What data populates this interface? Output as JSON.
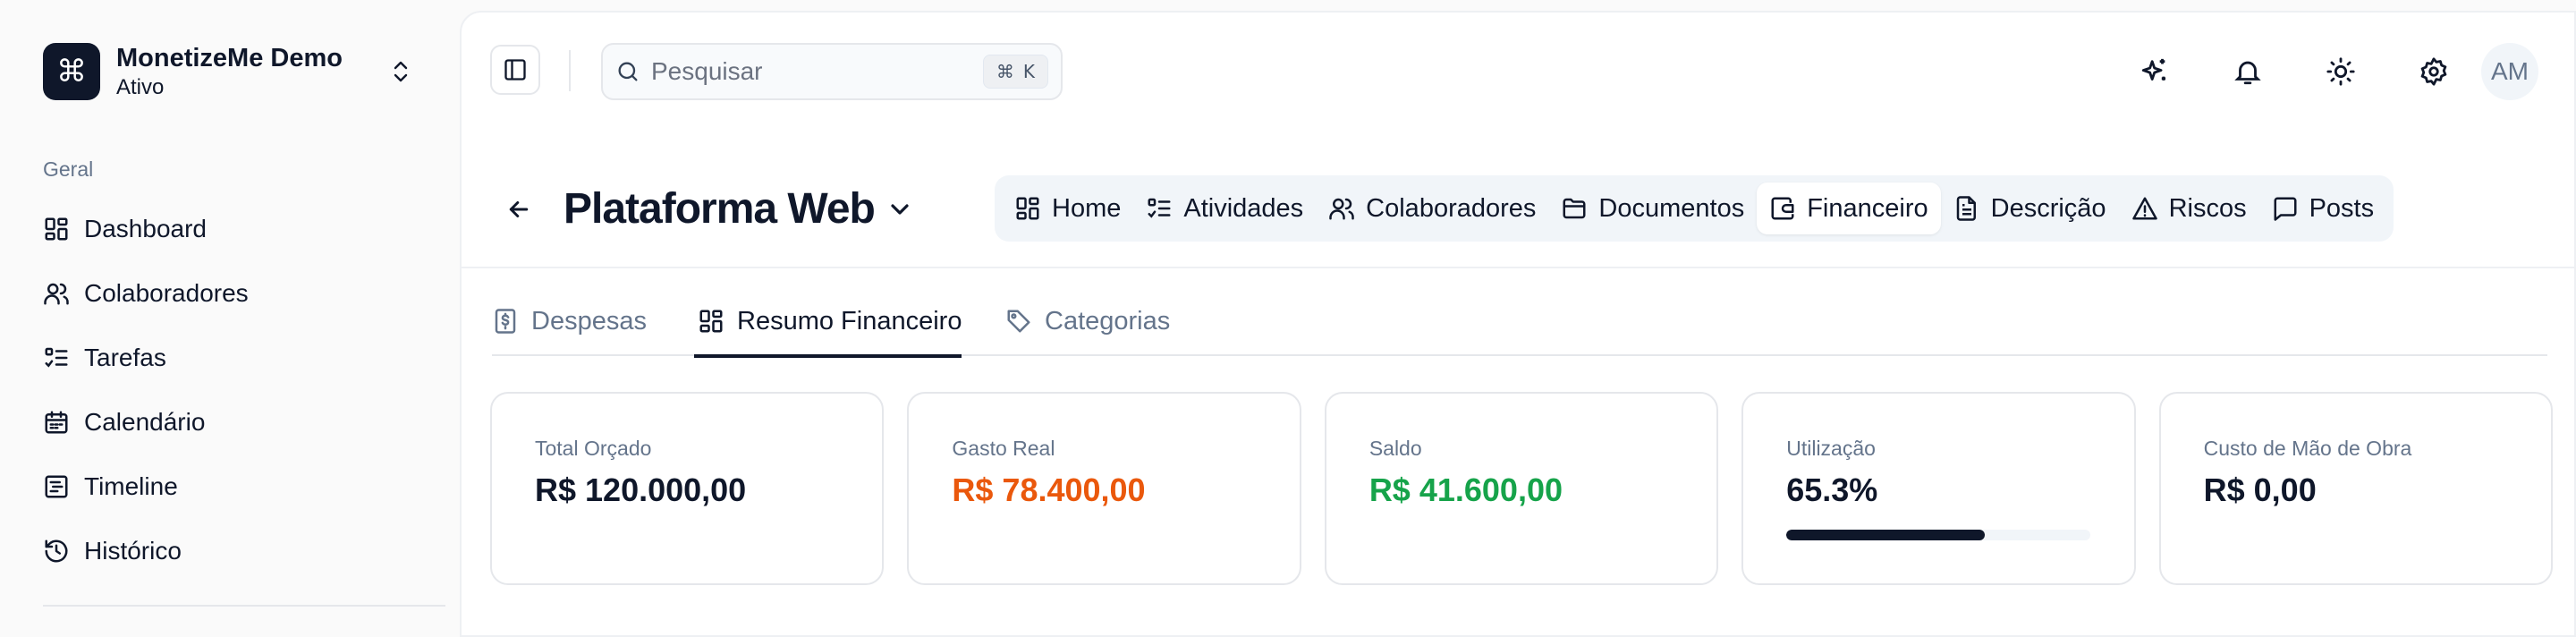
{
  "workspace": {
    "name": "MonetizeMe Demo",
    "status": "Ativo",
    "logo_icon": "command-icon"
  },
  "sidebar": {
    "group_label": "Geral",
    "items": [
      {
        "label": "Dashboard",
        "icon": "dashboard-icon"
      },
      {
        "label": "Colaboradores",
        "icon": "users-icon"
      },
      {
        "label": "Tarefas",
        "icon": "list-check-icon"
      },
      {
        "label": "Calendário",
        "icon": "calendar-icon"
      },
      {
        "label": "Timeline",
        "icon": "timeline-icon"
      },
      {
        "label": "Histórico",
        "icon": "history-icon"
      }
    ]
  },
  "search": {
    "placeholder": "Pesquisar",
    "shortcut_symbol": "⌘",
    "shortcut_key": "K"
  },
  "user": {
    "initials": "AM"
  },
  "project": {
    "title": "Plataforma Web"
  },
  "nav_tabs": [
    {
      "label": "Home",
      "icon": "home-grid-icon",
      "active": false
    },
    {
      "label": "Atividades",
      "icon": "list-check-icon",
      "active": false
    },
    {
      "label": "Colaboradores",
      "icon": "users-icon",
      "active": false
    },
    {
      "label": "Documentos",
      "icon": "folder-icon",
      "active": false
    },
    {
      "label": "Financeiro",
      "icon": "wallet-icon",
      "active": true
    },
    {
      "label": "Descrição",
      "icon": "file-text-icon",
      "active": false
    },
    {
      "label": "Riscos",
      "icon": "alert-triangle-icon",
      "active": false
    },
    {
      "label": "Posts",
      "icon": "message-square-icon",
      "active": false
    }
  ],
  "subtabs": [
    {
      "label": "Despesas",
      "icon": "receipt-dollar-icon",
      "active": false
    },
    {
      "label": "Resumo Financeiro",
      "icon": "dashboard-icon",
      "active": true
    },
    {
      "label": "Categorias",
      "icon": "tag-icon",
      "active": false
    }
  ],
  "cards": [
    {
      "label": "Total Orçado",
      "value": "R$ 120.000,00",
      "color": "#0f172a"
    },
    {
      "label": "Gasto Real",
      "value": "R$ 78.400,00",
      "color": "#ea580c"
    },
    {
      "label": "Saldo",
      "value": "R$ 41.600,00",
      "color": "#16a34a"
    },
    {
      "label": "Utilização",
      "value": "65.3%",
      "progress_percent": 65.3
    },
    {
      "label": "Custo de Mão de Obra",
      "value": "R$ 0,00",
      "color": "#0f172a"
    }
  ]
}
